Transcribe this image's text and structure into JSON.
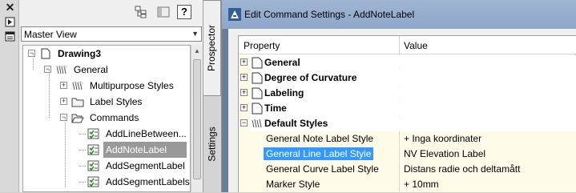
{
  "left_toolbar": {
    "icons": [
      "close-icon",
      "pin-icon",
      "properties-icon"
    ]
  },
  "panel": {
    "toolbar_icons": [
      "structure-icon",
      "item-view-icon",
      "help-icon"
    ],
    "help_label": "?",
    "view_select": {
      "value": "Master View"
    },
    "tree": [
      {
        "label": "Drawing3",
        "level": 0,
        "expander": "-",
        "icon": "drawing-icon",
        "bold": true
      },
      {
        "label": "General",
        "level": 1,
        "expander": "-",
        "icon": "styles-collection-icon",
        "bold": false
      },
      {
        "label": "Multipurpose Styles",
        "level": 2,
        "expander": "+",
        "icon": "styles-collection-icon",
        "bold": false
      },
      {
        "label": "Label Styles",
        "level": 2,
        "expander": "+",
        "icon": "folder-icon",
        "bold": false
      },
      {
        "label": "Commands",
        "level": 2,
        "expander": "-",
        "icon": "folder-open-icon",
        "bold": false
      },
      {
        "label": "AddLineBetween...",
        "level": 3,
        "expander": "",
        "icon": "command-icon",
        "bold": false
      },
      {
        "label": "AddNoteLabel",
        "level": 3,
        "expander": "",
        "icon": "command-icon",
        "bold": false,
        "selected": true
      },
      {
        "label": "AddSegmentLabel",
        "level": 3,
        "expander": "",
        "icon": "command-icon",
        "bold": false
      },
      {
        "label": "AddSegmentLabels",
        "level": 3,
        "expander": "",
        "icon": "command-icon",
        "bold": false
      }
    ]
  },
  "tabs": [
    {
      "label": "Prospector",
      "active": true
    },
    {
      "label": "Settings",
      "active": false
    }
  ],
  "dialog": {
    "title": "Edit Command Settings - AddNoteLabel",
    "columns": {
      "property": "Property",
      "value": "Value"
    },
    "rows": [
      {
        "type": "category",
        "expander": "+",
        "label": "General",
        "icon": "page-icon"
      },
      {
        "type": "category",
        "expander": "+",
        "label": "Degree of Curvature",
        "icon": "page-icon"
      },
      {
        "type": "category",
        "expander": "+",
        "label": "Labeling",
        "icon": "page-icon"
      },
      {
        "type": "category",
        "expander": "+",
        "label": "Time",
        "icon": "page-icon"
      },
      {
        "type": "category",
        "expander": "-",
        "label": "Default Styles",
        "icon": "styles-collection-icon"
      },
      {
        "type": "property",
        "label": "General Note Label Style",
        "value": "+ Inga koordinater"
      },
      {
        "type": "property",
        "label": "General Line Label Style",
        "value": "NV Elevation Label",
        "selected": true
      },
      {
        "type": "property",
        "label": "General Curve Label Style",
        "value": "Distans radie och deltamått"
      },
      {
        "type": "property",
        "label": "Marker Style",
        "value": "+ 10mm"
      }
    ]
  },
  "colors": {
    "selection": "#3399ff",
    "tree_selection": "#999999",
    "title_bar": "#9fb5d3",
    "grid_tint": "#fffbe9"
  }
}
